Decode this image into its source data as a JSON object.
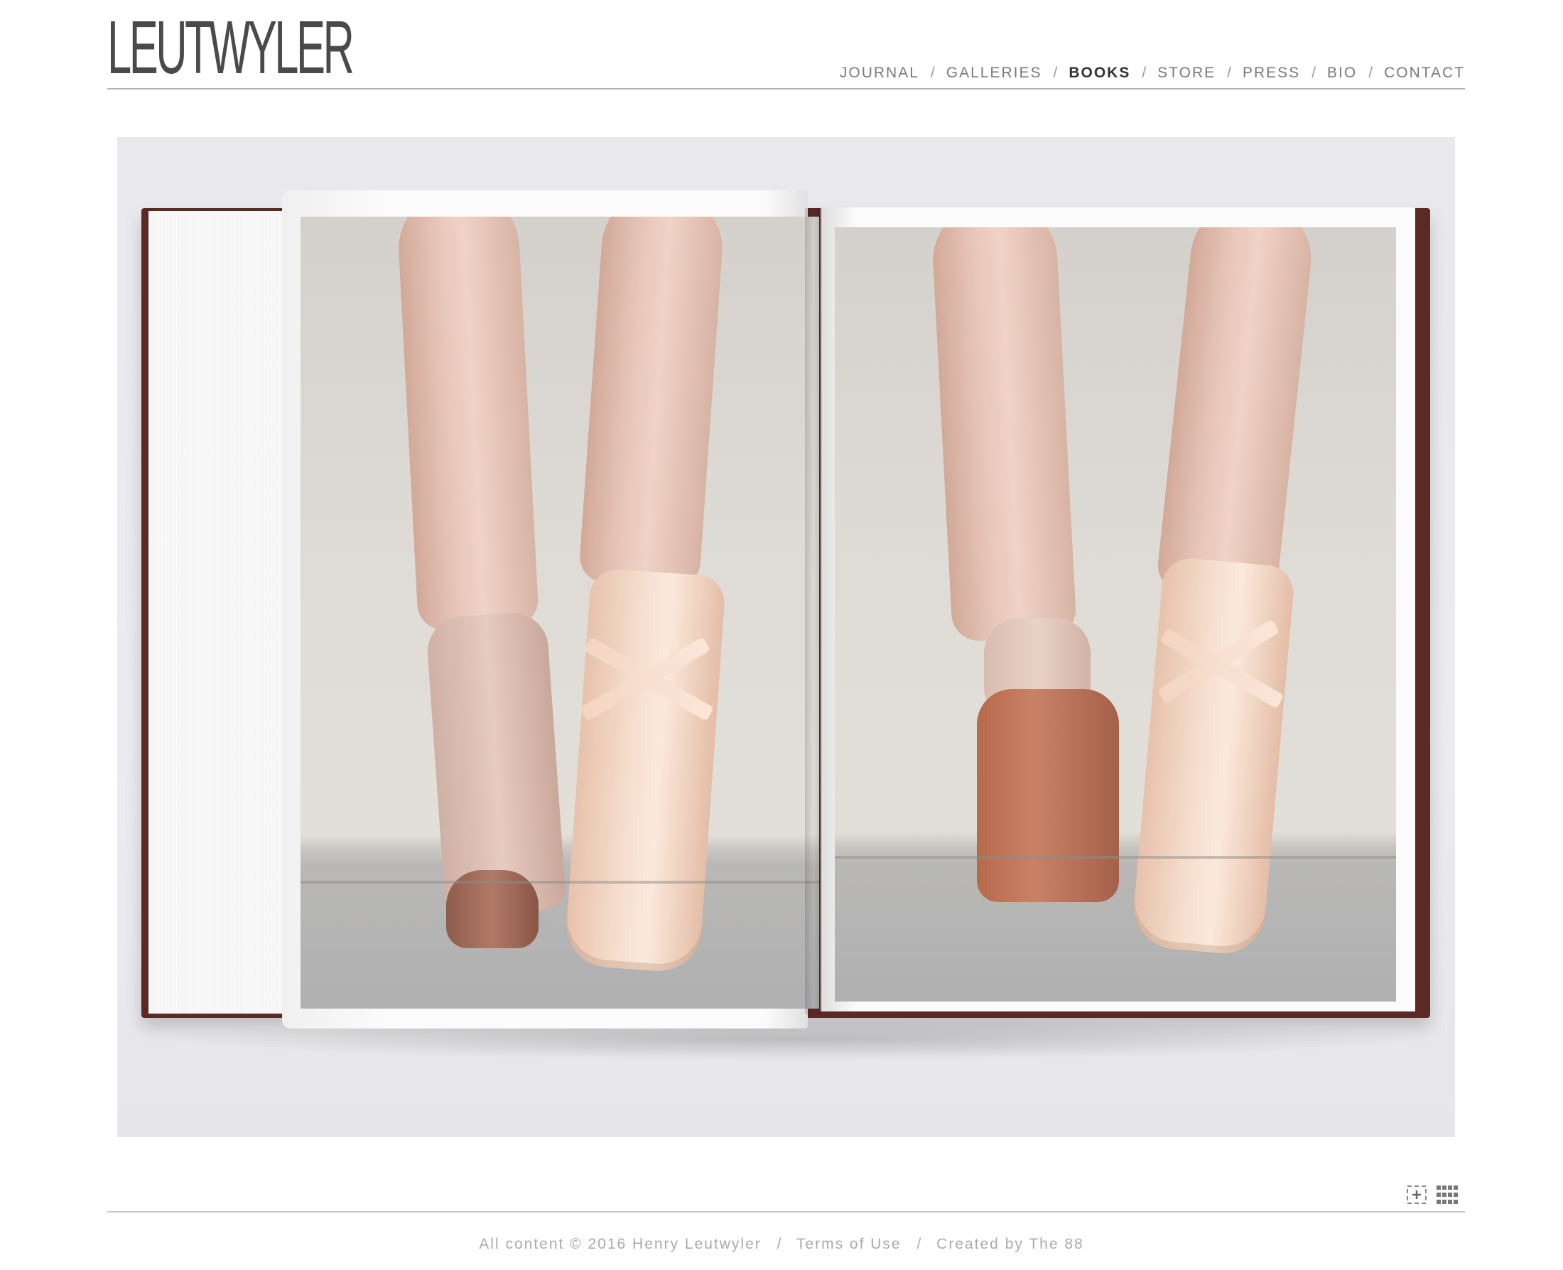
{
  "brand": {
    "logo_text": "LEUTWYLER"
  },
  "nav": {
    "items": [
      {
        "label": "JOURNAL"
      },
      {
        "label": "GALLERIES"
      },
      {
        "label": "BOOKS",
        "active": true
      },
      {
        "label": "STORE"
      },
      {
        "label": "PRESS"
      },
      {
        "label": "BIO"
      },
      {
        "label": "CONTACT"
      }
    ],
    "separator": "/"
  },
  "viewer": {
    "controls": [
      {
        "icon": "fullscreen-icon"
      },
      {
        "icon": "grid-icon"
      }
    ]
  },
  "footer": {
    "copyright": "All content © 2016 Henry Leutwyler",
    "terms": "Terms of Use",
    "credit": "Created by The 88",
    "separator": "/"
  },
  "colors": {
    "nav_active": "#333333",
    "nav_text": "#7a7a7a",
    "footer_text": "#aaaaaa",
    "book_cover": "#5a2a26"
  }
}
